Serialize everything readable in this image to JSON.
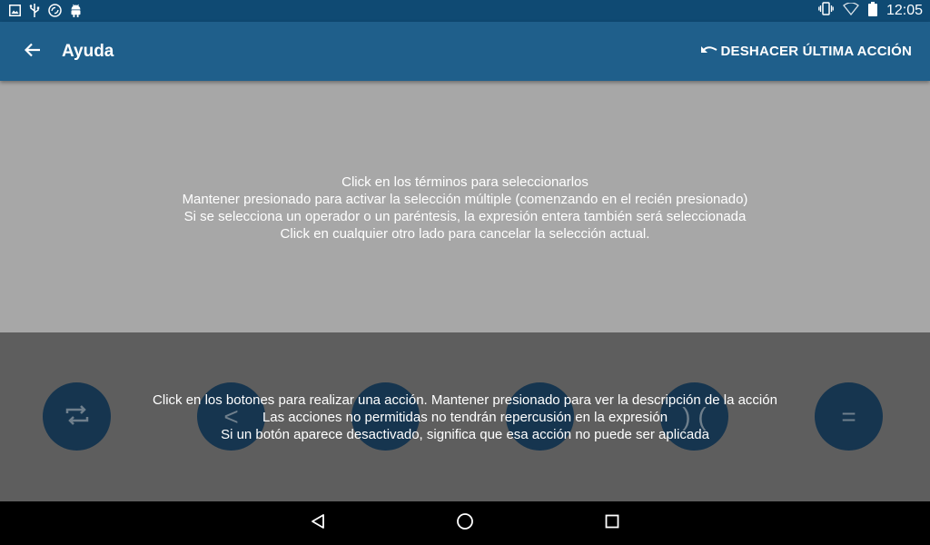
{
  "status_bar": {
    "time": "12:05",
    "left_icons": [
      "image-icon",
      "usb-icon",
      "sync-icon",
      "android-icon"
    ],
    "right_icons": [
      "vibrate-icon",
      "wifi-icon",
      "battery-icon"
    ]
  },
  "app_bar": {
    "title": "Ayuda",
    "undo_label": "DESHACER ÚLTIMA ACCIÓN",
    "color": "#1f5f8b"
  },
  "help_top": {
    "lines": [
      "Click en los términos para seleccionarlos",
      "Mantener presionado para activar la selección múltiple (comenzando en el recién presionado)",
      "Si se selecciona un operador o un paréntesis, la expresión entera también será seleccionada",
      "Click en cualquier otro lado para cancelar la selección actual."
    ]
  },
  "help_bottom": {
    "lines": [
      "Click en los botones para realizar una acción. Mantener presionado para ver la descripción de la acción",
      "Las acciones no permitidas no tendrán repercusión en la expresión",
      "Si un botón aparece desactivado, significa que esa acción no puede ser aplicada"
    ]
  },
  "action_buttons": [
    {
      "name": "swap-button",
      "label": "",
      "icon": "swap-icon"
    },
    {
      "name": "move-left-button",
      "label": "<",
      "icon": "chevron-left-icon"
    },
    {
      "name": "action-button-3",
      "label": "",
      "icon": ""
    },
    {
      "name": "action-button-4",
      "label": "",
      "icon": ""
    },
    {
      "name": "parenthesis-button",
      "label": ") (",
      "icon": ""
    },
    {
      "name": "equals-button",
      "label": "=",
      "icon": "equals-icon"
    }
  ],
  "nav_bar": {
    "buttons": [
      "back-triangle-icon",
      "home-circle-icon",
      "recents-square-icon"
    ]
  },
  "colors": {
    "status_bar": "#0f4a73",
    "expression_area": "#a7a7a7",
    "buttons_area": "#5e5e5e",
    "action_button": "#16354f"
  }
}
